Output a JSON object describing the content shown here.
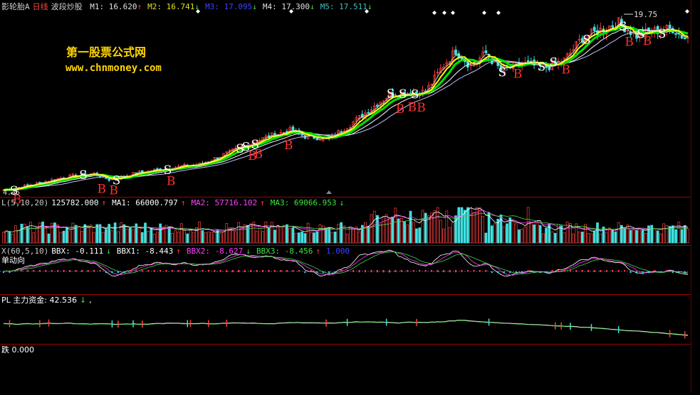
{
  "main": {
    "title": "影轮胎A",
    "period": "日线",
    "indicator": "波段炒股",
    "ma": [
      {
        "label": "M1: 16.620",
        "arrow": "↑",
        "color": "#e0e0e0"
      },
      {
        "label": "M2: 16.741",
        "arrow": "↓",
        "color": "#e0e020"
      },
      {
        "label": "M3: 17.095",
        "arrow": "↓",
        "color": "#4040ff"
      },
      {
        "label": "M4: 17.300",
        "arrow": "↓",
        "color": "#e0e0e0"
      },
      {
        "label": "M5: 17.511",
        "arrow": "↓",
        "color": "#40c0c0"
      }
    ],
    "high_label": "19.75",
    "low_label": "4.45"
  },
  "watermark": {
    "line1": "第一股票公式网",
    "line2": "www.chnmoney.com"
  },
  "volume": {
    "title": "L(5,10,20)",
    "value": "125782.000",
    "value_arrow": "↑",
    "ma1": "MA1: 66000.797",
    "ma1_arrow": "↑",
    "ma2": "MA2: 57716.102",
    "ma2_arrow": "↑",
    "ma3": "MA3: 69066.953",
    "ma3_arrow": "↓"
  },
  "bbx": {
    "title": "X(60,5,10)",
    "bbx": "BBX: -0.111",
    "bbx_arrow": "↓",
    "bbx1": "BBX1: -8.443",
    "bbx1_arrow": "↑",
    "bbx2": "BBX2: -8.627",
    "bbx2_arrow": "↓",
    "bbx3": "BBX3: -8.456",
    "bbx3_arrow": "↑",
    "extra": "1.000",
    "subtitle": "单动向"
  },
  "fund": {
    "title": "PL 主力资金: 42.536",
    "arrow": "↓",
    "suffix": ","
  },
  "bottom": {
    "title": "跌 0.000"
  },
  "signals": {
    "buy": "B",
    "sell": "S"
  },
  "colors": {
    "up": "#ff4040",
    "down": "#40e0e0",
    "grid": "#a00000",
    "ma_yellow": "#ffff00",
    "ma_green": "#00dd00",
    "ma_white": "#ffffff"
  },
  "chart_data": {
    "type": "line",
    "ylabel": "",
    "xlabel": "",
    "ylim": [
      4.45,
      19.75
    ],
    "close_anchors": [
      [
        0,
        4.6
      ],
      [
        10,
        5.1
      ],
      [
        20,
        5.7
      ],
      [
        30,
        6.0
      ],
      [
        35,
        5.5
      ],
      [
        45,
        6.1
      ],
      [
        55,
        6.5
      ],
      [
        65,
        6.8
      ],
      [
        72,
        7.5
      ],
      [
        80,
        8.4
      ],
      [
        88,
        9.2
      ],
      [
        95,
        9.7
      ],
      [
        100,
        9.2
      ],
      [
        108,
        9.0
      ],
      [
        115,
        10.2
      ],
      [
        122,
        11.6
      ],
      [
        128,
        12.8
      ],
      [
        133,
        12.9
      ],
      [
        140,
        13.0
      ],
      [
        146,
        15.3
      ],
      [
        150,
        16.5
      ],
      [
        155,
        15.2
      ],
      [
        160,
        16.3
      ],
      [
        165,
        14.8
      ],
      [
        172,
        15.4
      ],
      [
        180,
        15.1
      ],
      [
        186,
        15.7
      ],
      [
        192,
        17.6
      ],
      [
        198,
        18.3
      ],
      [
        204,
        18.9
      ],
      [
        210,
        17.8
      ],
      [
        216,
        18.2
      ],
      [
        222,
        18.4
      ],
      [
        226,
        17.6
      ]
    ],
    "buy_signals": [
      4,
      32,
      36,
      55,
      82,
      84,
      94,
      131,
      135,
      138,
      170,
      186,
      207,
      213
    ],
    "sell_signals": [
      3,
      26,
      37,
      54,
      78,
      80,
      83,
      128,
      132,
      136,
      165,
      178,
      182,
      193,
      205,
      211,
      218
    ]
  }
}
